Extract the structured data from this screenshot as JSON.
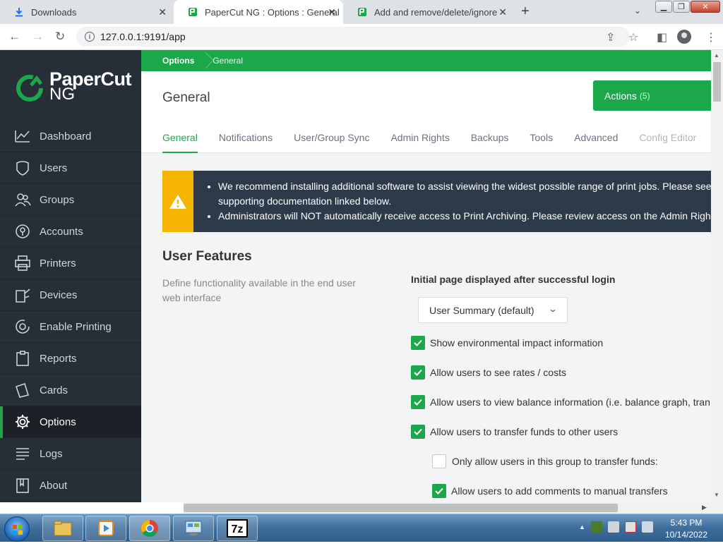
{
  "browser": {
    "tabs": [
      {
        "title": "Downloads",
        "icon": "download-icon",
        "active": false
      },
      {
        "title": "PaperCut NG : Options : General",
        "icon": "papercut-favicon",
        "active": true
      },
      {
        "title": "Add and remove/delete/ignore p",
        "icon": "papercut-favicon",
        "active": false
      }
    ],
    "url": "127.0.0.1:9191/app"
  },
  "brand": {
    "name_line1": "PaperCut",
    "name_line2": "NG",
    "accent_color": "#1aa84a"
  },
  "sidebar": {
    "items": [
      {
        "label": "Dashboard",
        "icon": "dashboard-icon"
      },
      {
        "label": "Users",
        "icon": "users-icon"
      },
      {
        "label": "Groups",
        "icon": "groups-icon"
      },
      {
        "label": "Accounts",
        "icon": "accounts-icon"
      },
      {
        "label": "Printers",
        "icon": "printer-icon"
      },
      {
        "label": "Devices",
        "icon": "devices-icon"
      },
      {
        "label": "Enable Printing",
        "icon": "enable-printing-icon"
      },
      {
        "label": "Reports",
        "icon": "reports-icon"
      },
      {
        "label": "Cards",
        "icon": "cards-icon"
      },
      {
        "label": "Options",
        "icon": "gear-icon",
        "active": true
      },
      {
        "label": "Logs",
        "icon": "logs-icon"
      },
      {
        "label": "About",
        "icon": "about-icon"
      }
    ]
  },
  "breadcrumb": {
    "root": "Options",
    "current": "General"
  },
  "page": {
    "title": "General",
    "actions_label": "Actions",
    "actions_count": "(5)",
    "tabs": [
      "General",
      "Notifications",
      "User/Group Sync",
      "Admin Rights",
      "Backups",
      "Tools",
      "Advanced",
      "Config Editor"
    ]
  },
  "alert": {
    "line1": "We recommend installing additional software to assist viewing the widest possible range of print jobs. Please see",
    "line2": "supporting documentation linked below.",
    "line3": "Administrators will NOT automatically receive access to Print Archiving. Please review access on the Admin Rights"
  },
  "user_features": {
    "title": "User Features",
    "description": "Define functionality available in the end user web interface",
    "initial_page_label": "Initial page displayed after successful login",
    "initial_page_value": "User Summary (default)",
    "options": [
      {
        "label": "Show environmental impact information",
        "checked": true
      },
      {
        "label": "Allow users to see rates / costs",
        "checked": true
      },
      {
        "label": "Allow users to view balance information (i.e. balance graph, tran",
        "checked": true
      },
      {
        "label": "Allow users to transfer funds to other users",
        "checked": true
      },
      {
        "label": "Only allow users in this group to transfer funds:",
        "checked": false
      },
      {
        "label": "Allow users to add comments to manual transfers",
        "checked": true
      }
    ]
  },
  "taskbar": {
    "time": "5:43 PM",
    "date": "10/14/2022"
  }
}
